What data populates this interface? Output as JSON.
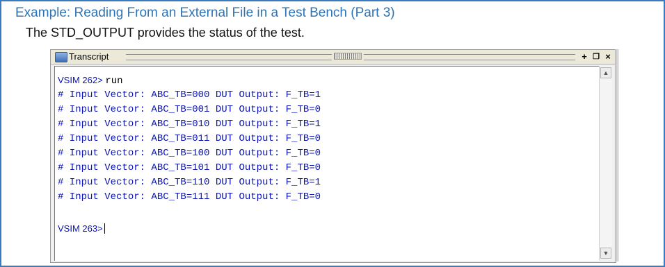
{
  "slide": {
    "title": "Example: Reading From an External File in a Test Bench (Part 3)",
    "subtitle": "The STD_OUTPUT provides the status of the test."
  },
  "window": {
    "title": "Transcript",
    "buttons": {
      "add": "+",
      "undock": "❐",
      "close": "×"
    }
  },
  "console": {
    "prompt1": "VSIM 262>",
    "command1": "run",
    "lines": [
      "# Input Vector: ABC_TB=000 DUT Output: F_TB=1",
      "# Input Vector: ABC_TB=001 DUT Output: F_TB=0",
      "# Input Vector: ABC_TB=010 DUT Output: F_TB=1",
      "# Input Vector: ABC_TB=011 DUT Output: F_TB=0",
      "# Input Vector: ABC_TB=100 DUT Output: F_TB=0",
      "# Input Vector: ABC_TB=101 DUT Output: F_TB=0",
      "# Input Vector: ABC_TB=110 DUT Output: F_TB=1",
      "# Input Vector: ABC_TB=111 DUT Output: F_TB=0"
    ],
    "prompt2": "VSIM 263>"
  },
  "scrollbar": {
    "up": "▲",
    "down": "▼"
  },
  "colors": {
    "accent": "#2e74b5",
    "console_text": "#0a14b4",
    "border": "#3a7bbf"
  }
}
